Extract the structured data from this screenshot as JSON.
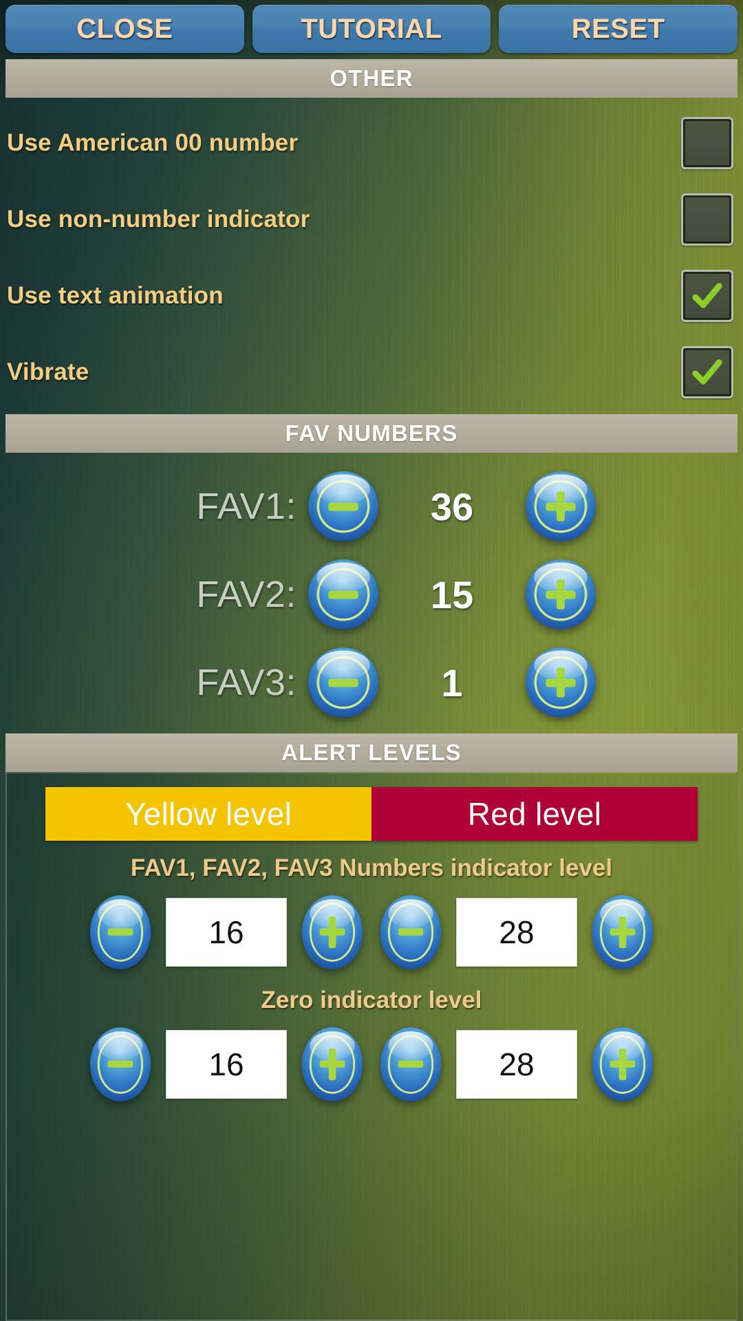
{
  "topbar": {
    "buttons": [
      {
        "label": "CLOSE",
        "name": "close-button"
      },
      {
        "label": "TUTORIAL",
        "name": "tutorial-button"
      },
      {
        "label": "RESET",
        "name": "reset-button"
      }
    ]
  },
  "sections": {
    "other": "OTHER",
    "fav_numbers": "FAV NUMBERS",
    "alert_levels": "ALERT LEVELS"
  },
  "other_options": [
    {
      "label": "Use American 00 number",
      "checked": false
    },
    {
      "label": "Use non-number indicator",
      "checked": false
    },
    {
      "label": "Use text animation",
      "checked": true
    },
    {
      "label": "Vibrate",
      "checked": true
    }
  ],
  "fav_numbers": [
    {
      "label": "FAV1:",
      "value": "36"
    },
    {
      "label": "FAV2:",
      "value": "15"
    },
    {
      "label": "FAV3:",
      "value": "1"
    }
  ],
  "alert_levels": {
    "tabs": [
      {
        "label": "Yellow level",
        "color": "#f5c400"
      },
      {
        "label": "Red level",
        "color": "#b00038"
      }
    ],
    "groups": [
      {
        "title": "FAV1, FAV2, FAV3 Numbers indicator level",
        "yellow_value": "16",
        "red_value": "28"
      },
      {
        "title": "Zero indicator level",
        "yellow_value": "16",
        "red_value": "28"
      }
    ]
  },
  "icons": {
    "minus": "minus-icon",
    "plus": "plus-icon",
    "check": "check-icon"
  },
  "colors": {
    "button_text": "#ffd6a8",
    "option_text": "#f4cd80",
    "fav_label": "#c9cec4",
    "check_green": "#8bd02a",
    "yellow": "#f5c400",
    "red": "#b00038"
  }
}
